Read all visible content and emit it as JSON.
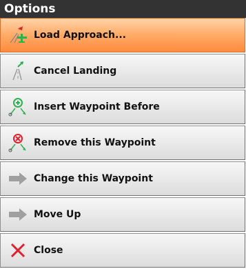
{
  "dialog": {
    "title": "Options",
    "items": [
      {
        "label": "Load Approach...",
        "icon": "approach-plane-icon",
        "selected": true
      },
      {
        "label": "Cancel Landing",
        "icon": "runway-icon"
      },
      {
        "label": "Insert Waypoint Before",
        "icon": "insert-waypoint-icon"
      },
      {
        "label": "Remove this Waypoint",
        "icon": "remove-waypoint-icon"
      },
      {
        "label": "Change this Waypoint",
        "icon": "arrow-right-icon"
      },
      {
        "label": "Move Up",
        "icon": "arrow-right-icon"
      },
      {
        "label": "Close",
        "icon": "close-icon"
      }
    ]
  },
  "colors": {
    "title_bg": "#333333",
    "selected_bg": "#ff9a4d",
    "item_bg": "#e8e8e8",
    "green": "#2bb24c",
    "red": "#e0202a",
    "gray": "#a0a0a0"
  }
}
